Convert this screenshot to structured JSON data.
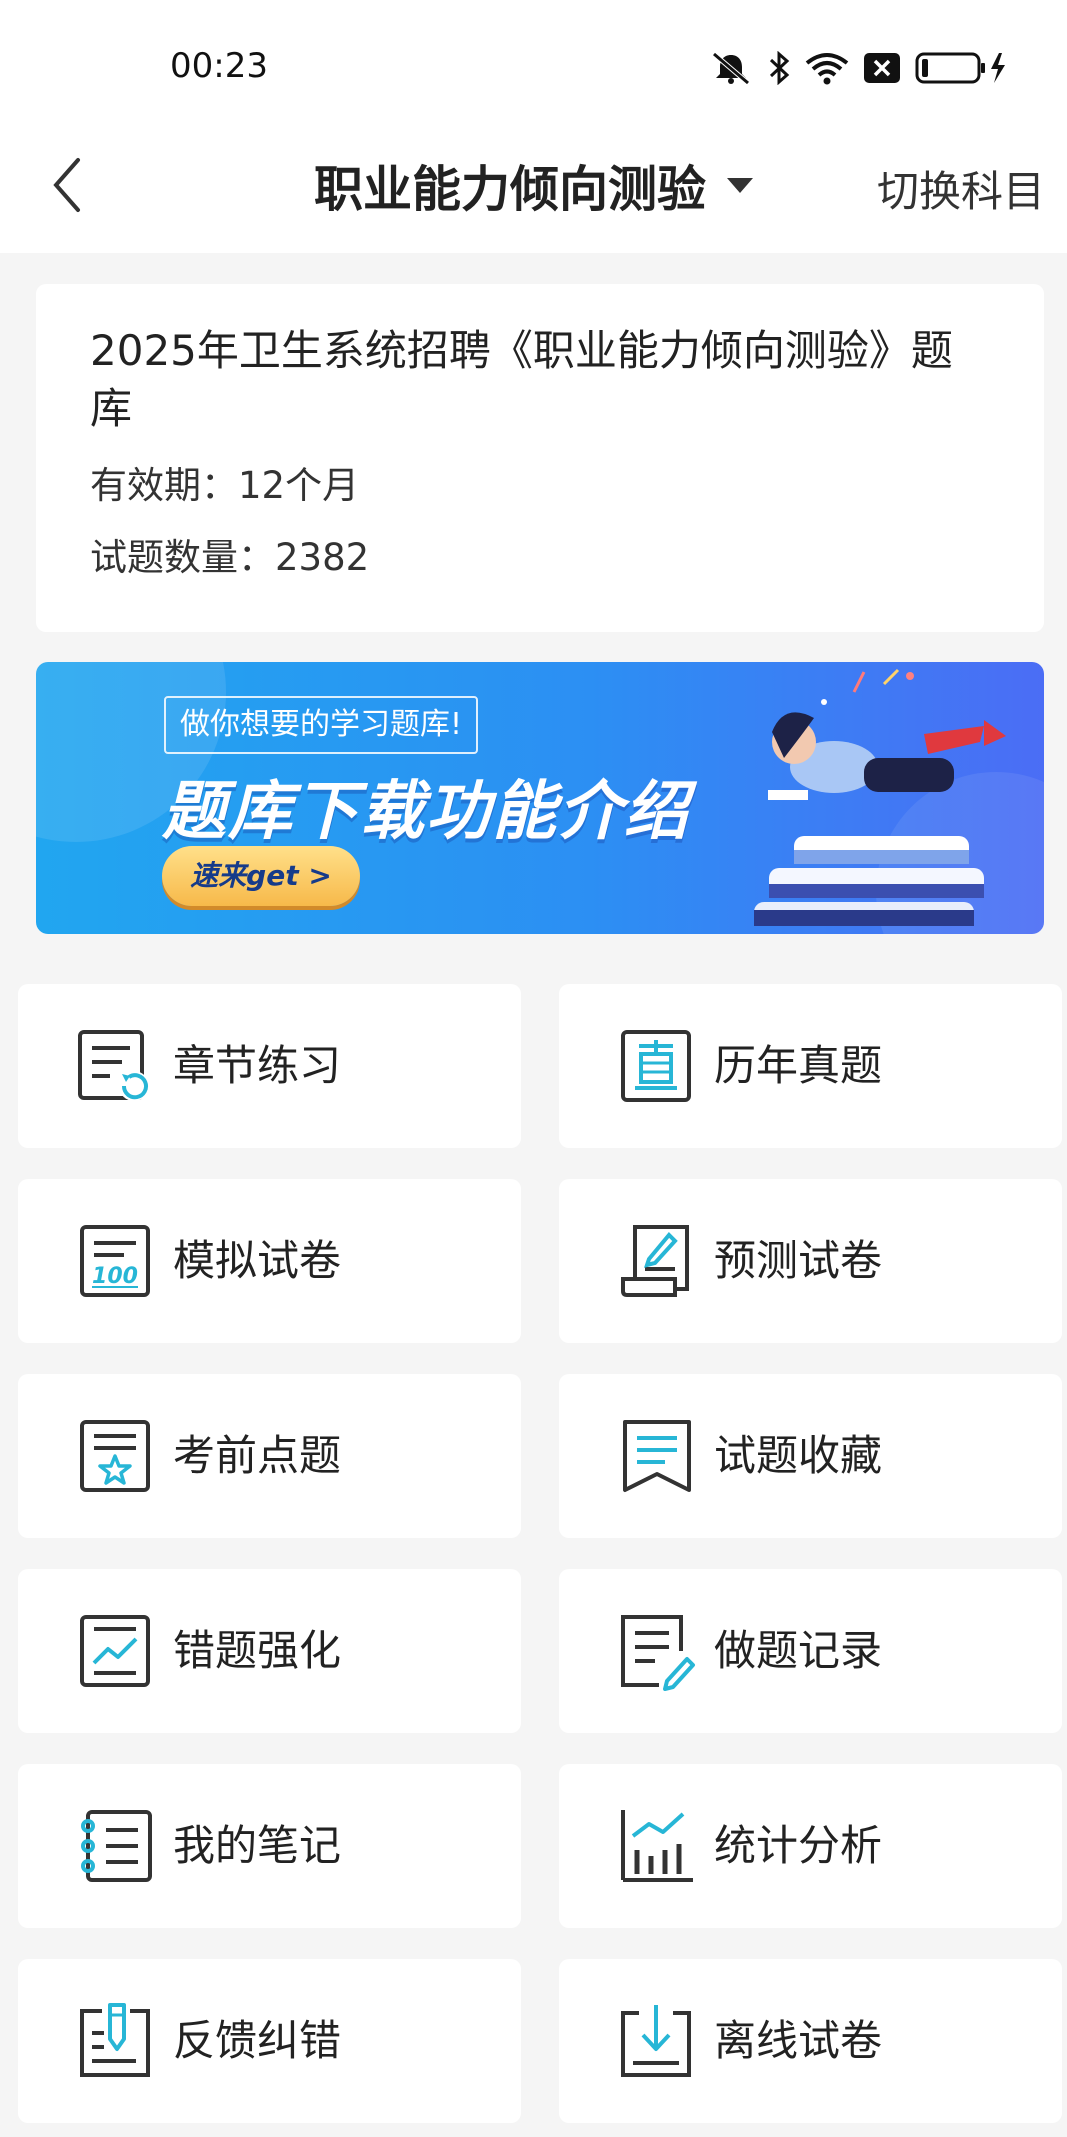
{
  "status_bar": {
    "time": "00:23"
  },
  "nav": {
    "title": "职业能力倾向测验",
    "switch_label": "切换科目"
  },
  "info_card": {
    "title": "2025年卫生系统招聘《职业能力倾向测验》题库",
    "validity": "有效期：12个月",
    "question_count": "试题数量：2382"
  },
  "banner": {
    "tag": "做你想要的学习题库!",
    "headline": "题库下载功能介绍",
    "cta": "速来get >"
  },
  "menu": [
    {
      "label": "章节练习",
      "icon": "chapter-practice-icon"
    },
    {
      "label": "历年真题",
      "icon": "past-exams-icon"
    },
    {
      "label": "模拟试卷",
      "icon": "mock-paper-icon"
    },
    {
      "label": "预测试卷",
      "icon": "prediction-paper-icon"
    },
    {
      "label": "考前点题",
      "icon": "pre-exam-tips-icon"
    },
    {
      "label": "试题收藏",
      "icon": "bookmark-icon"
    },
    {
      "label": "错题强化",
      "icon": "wrong-questions-icon"
    },
    {
      "label": "做题记录",
      "icon": "practice-record-icon"
    },
    {
      "label": "我的笔记",
      "icon": "notes-icon"
    },
    {
      "label": "统计分析",
      "icon": "statistics-icon"
    },
    {
      "label": "反馈纠错",
      "icon": "feedback-icon"
    },
    {
      "label": "离线试卷",
      "icon": "offline-download-icon"
    }
  ],
  "colors": {
    "accent": "#27b6d6",
    "icon_stroke": "#333333"
  }
}
